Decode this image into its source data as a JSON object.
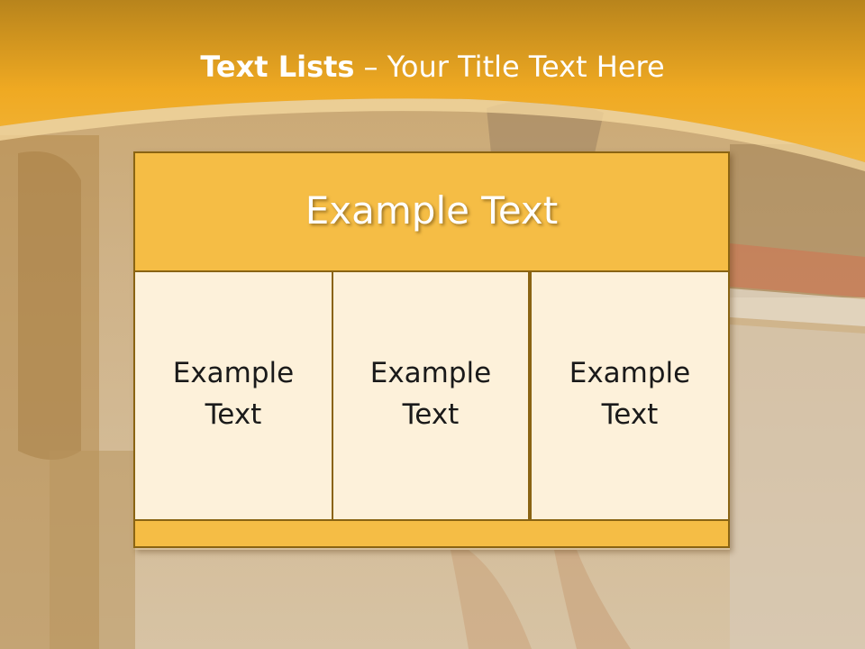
{
  "title": {
    "bold": "Text Lists",
    "rest": "– Your Title Text Here"
  },
  "diagram": {
    "header": "Example Text",
    "cells": [
      "Example Text",
      "Example Text",
      "Example Text"
    ]
  },
  "colors": {
    "accent": "#f5bd45",
    "border": "#8a6413",
    "cell_fill": "#fdf1da",
    "band": "#f0a820"
  }
}
